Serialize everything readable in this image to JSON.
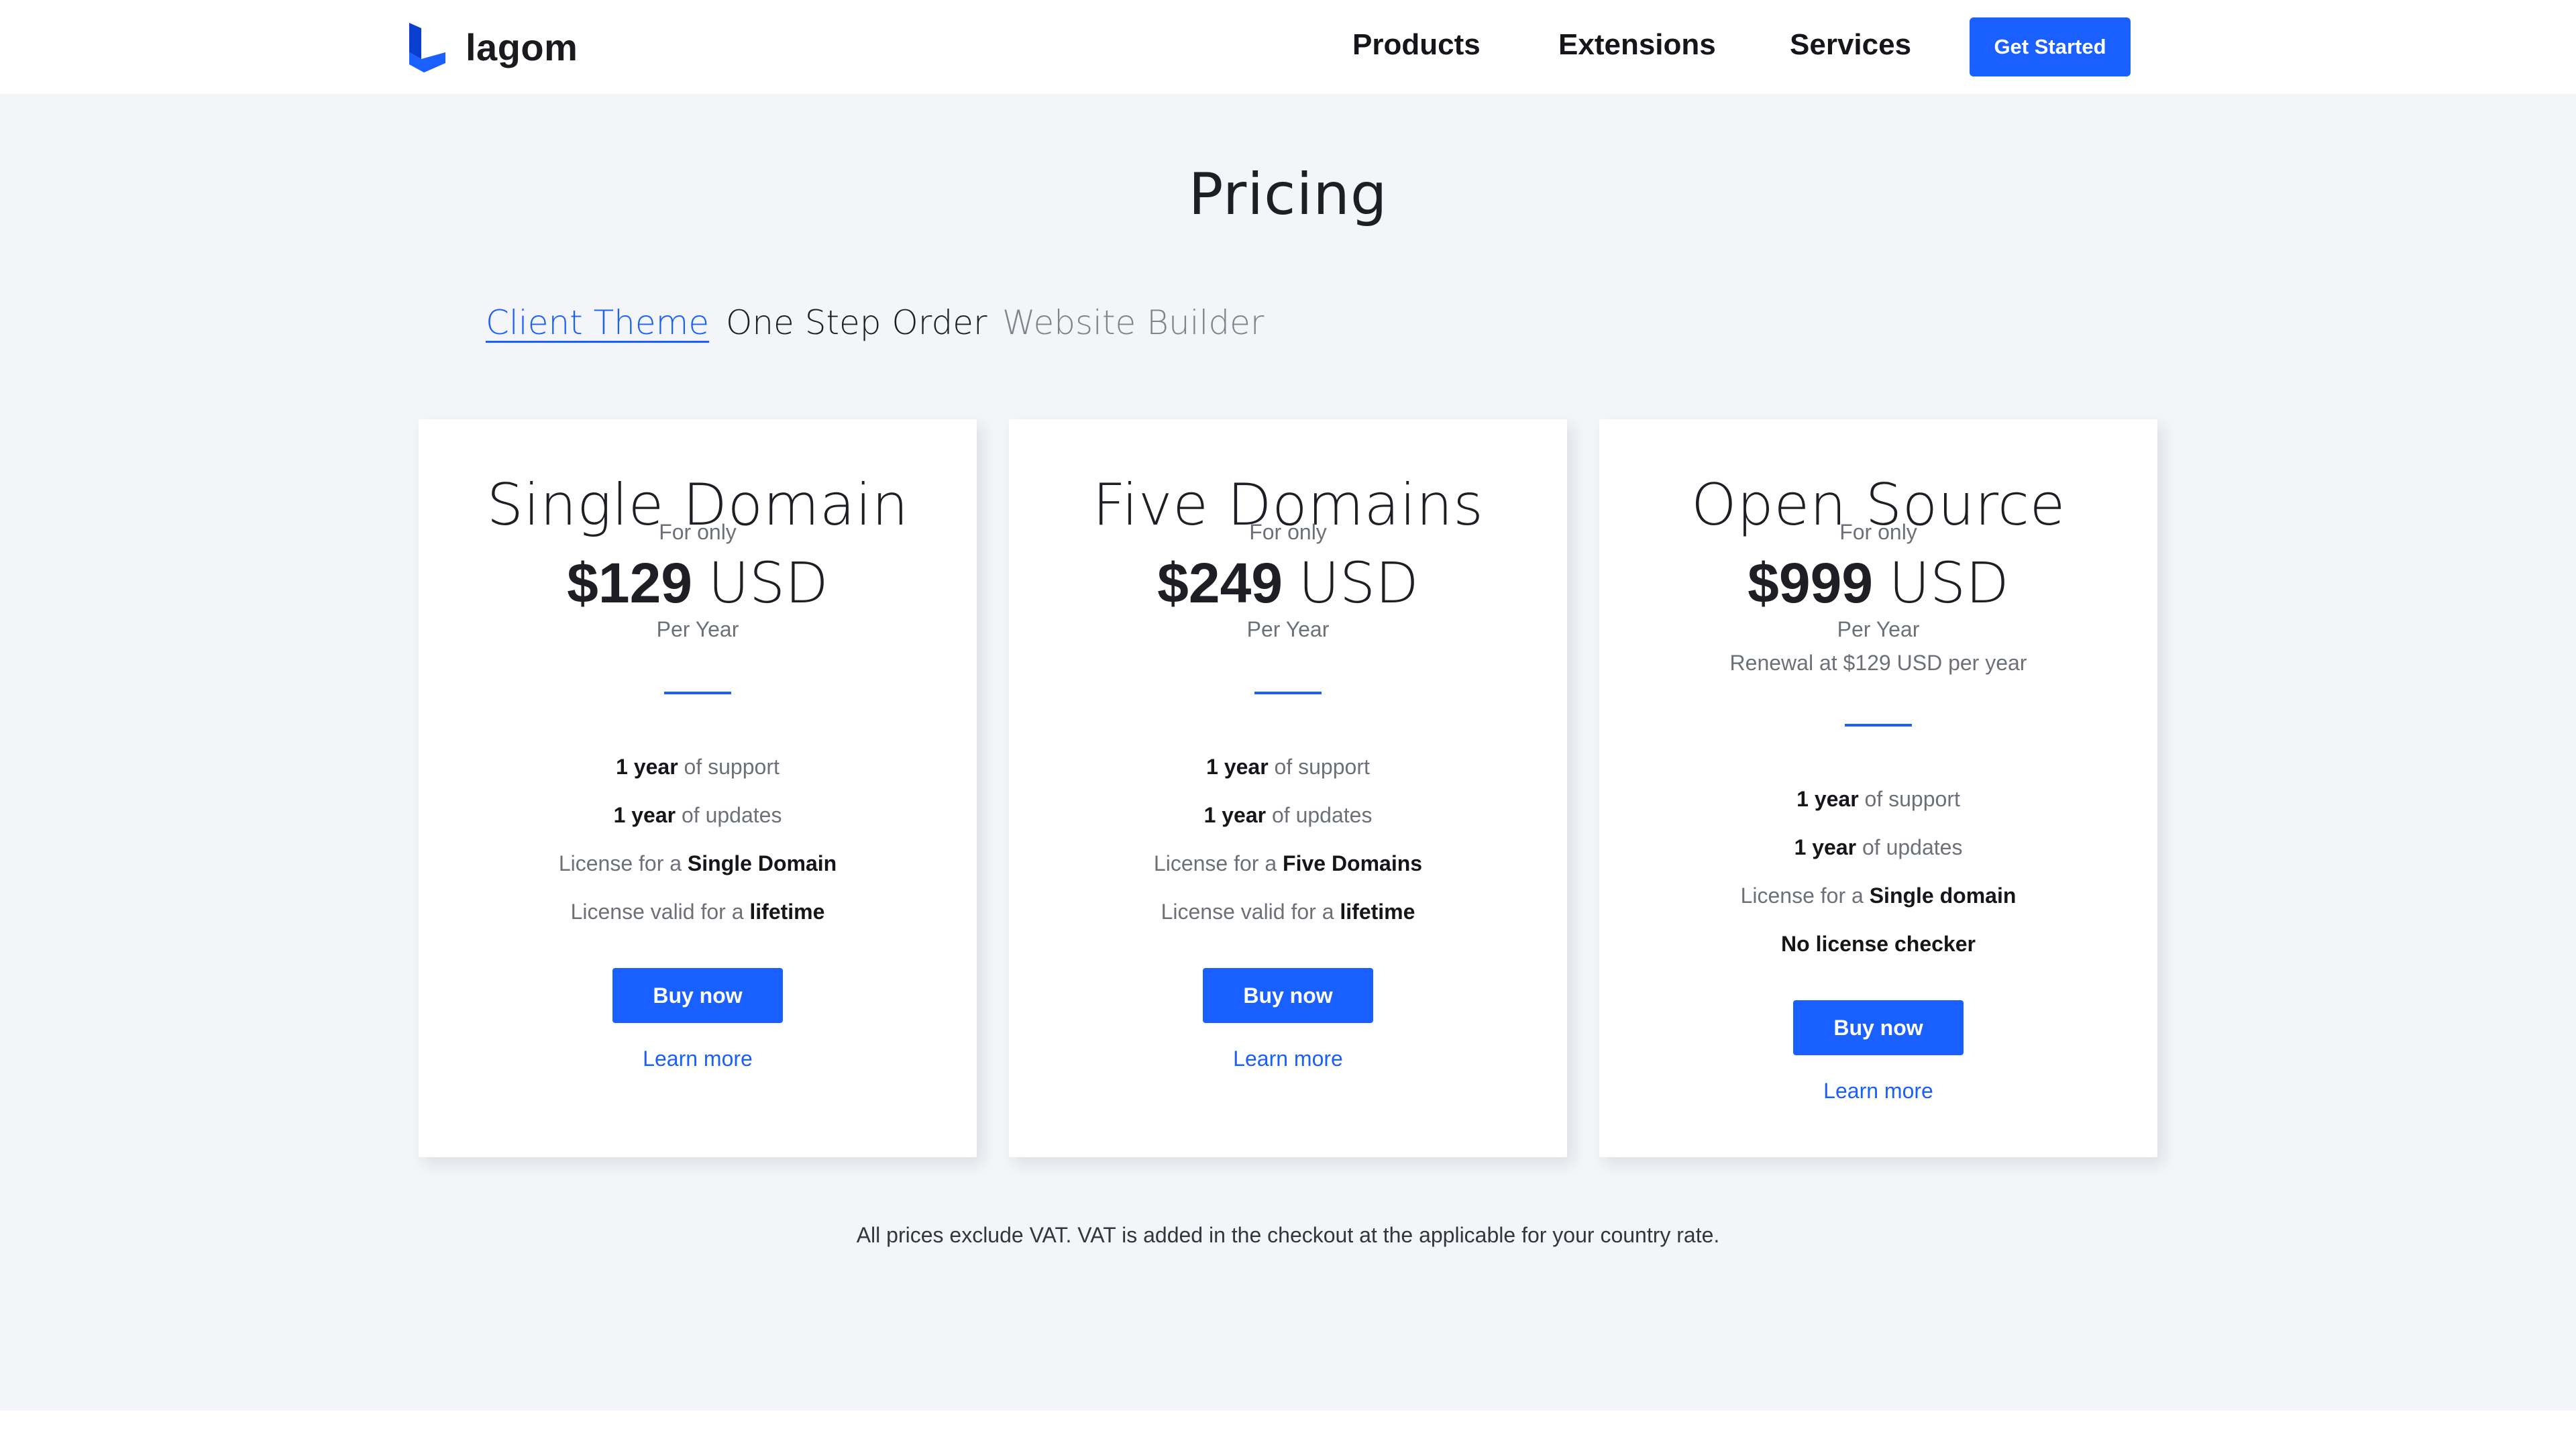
{
  "header": {
    "logo_text": "lagom",
    "nav": [
      {
        "label": "Products"
      },
      {
        "label": "Extensions"
      },
      {
        "label": "Services"
      }
    ],
    "cta_label": "Get Started",
    "brand_color": "#1a5fff"
  },
  "main": {
    "title": "Pricing",
    "tabs": [
      {
        "label": "Client Theme",
        "state": "active"
      },
      {
        "label": "One Step Order",
        "state": "default"
      },
      {
        "label": "Website Builder",
        "state": "muted"
      }
    ],
    "plans": [
      {
        "title": "Single Domain",
        "for_only": "For only",
        "price": "$129",
        "currency": "USD",
        "period": "Per Year",
        "renewal": "",
        "features": [
          {
            "strong": "1 year",
            "text": " of support"
          },
          {
            "strong": "1 year",
            "text": " of updates"
          },
          {
            "prefix": "License for a ",
            "strong": "Single Domain"
          },
          {
            "prefix": "License valid for a ",
            "strong": "lifetime"
          }
        ],
        "buy_label": "Buy now",
        "learn_label": "Learn more"
      },
      {
        "title": "Five Domains",
        "for_only": "For only",
        "price": "$249",
        "currency": "USD",
        "period": "Per Year",
        "renewal": "",
        "features": [
          {
            "strong": "1 year",
            "text": " of support"
          },
          {
            "strong": "1 year",
            "text": " of updates"
          },
          {
            "prefix": "License for a ",
            "strong": "Five Domains"
          },
          {
            "prefix": "License valid for a ",
            "strong": "lifetime"
          }
        ],
        "buy_label": "Buy now",
        "learn_label": "Learn more"
      },
      {
        "title": "Open Source",
        "for_only": "For only",
        "price": "$999",
        "currency": "USD",
        "period": "Per Year",
        "renewal": "Renewal at $129 USD per year",
        "features": [
          {
            "strong": "1 year",
            "text": " of support"
          },
          {
            "strong": "1 year",
            "text": " of updates"
          },
          {
            "prefix": "License for a ",
            "strong": "Single domain"
          },
          {
            "strong": "No license checker"
          }
        ],
        "buy_label": "Buy now",
        "learn_label": "Learn more"
      }
    ],
    "vat_note": "All prices exclude VAT. VAT is added in the checkout at the applicable for your country rate."
  }
}
